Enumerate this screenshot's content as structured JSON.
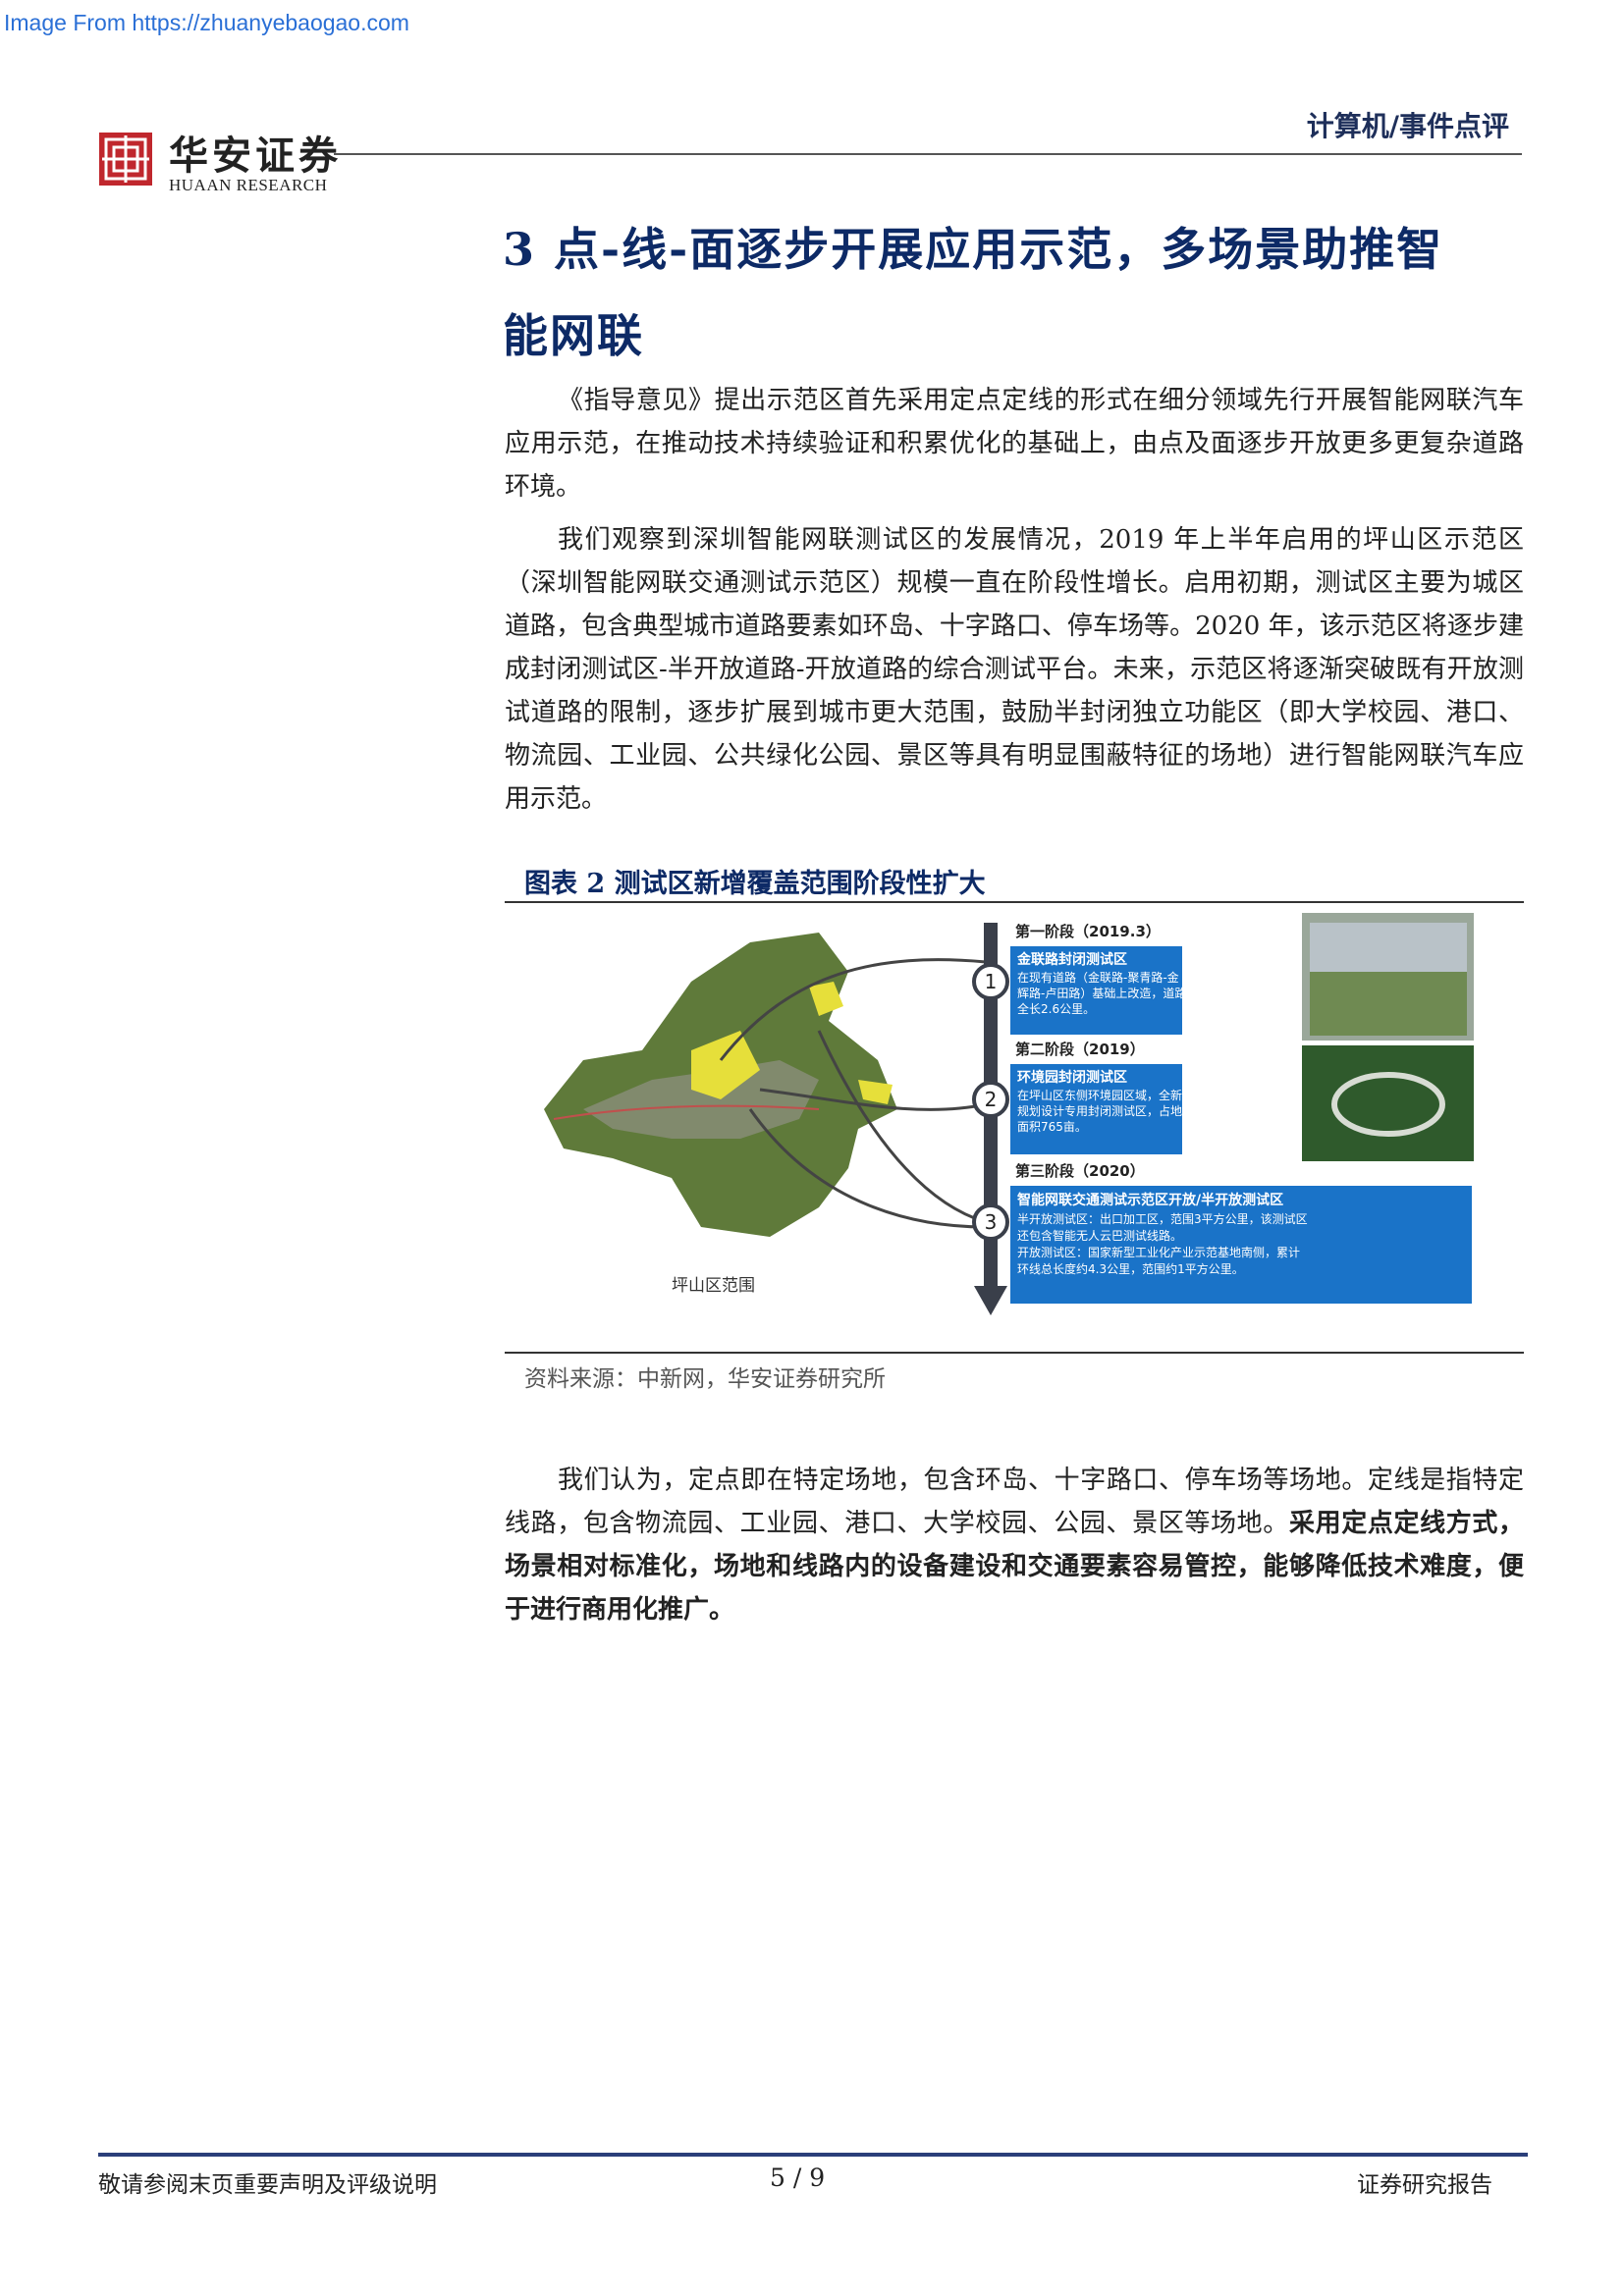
{
  "watermark": "Image From https://zhuanyebaogao.com",
  "header": {
    "logo_cn": "华安证券",
    "logo_en": "HUAAN RESEARCH",
    "category": "计算机/事件点评"
  },
  "section": {
    "title_line1": "3 点-线-面逐步开展应用示范，多场景助推智",
    "title_line2": "能网联"
  },
  "paragraphs": {
    "p1": "《指导意见》提出示范区首先采用定点定线的形式在细分领域先行开展智能网联汽车应用示范，在推动技术持续验证和积累优化的基础上，由点及面逐步开放更多更复杂道路环境。",
    "p2": "我们观察到深圳智能网联测试区的发展情况，2019 年上半年启用的坪山区示范区（深圳智能网联交通测试示范区）规模一直在阶段性增长。启用初期，测试区主要为城区道路，包含典型城市道路要素如环岛、十字路口、停车场等。2020 年，该示范区将逐步建成封闭测试区-半开放道路-开放道路的综合测试平台。未来，示范区将逐渐突破既有开放测试道路的限制，逐步扩展到城市更大范围，鼓励半封闭独立功能区（即大学校园、港口、物流园、工业园、公共绿化公园、景区等具有明显围蔽特征的场地）进行智能网联汽车应用示范。",
    "p3_normal": "我们认为，定点即在特定场地，包含环岛、十字路口、停车场等场地。定线是指特定线路，包含物流园、工业园、港口、大学校园、公园、景区等场地。",
    "p3_bold": "采用定点定线方式，场景相对标准化，场地和线路内的设备建设和交通要素容易管控，能够降低技术难度，便于进行商用化推广。"
  },
  "figure": {
    "title": "图表 2 测试区新增覆盖范围阶段性扩大",
    "map_label": "坪山区范围",
    "stages": [
      {
        "num": "1",
        "header": "第一阶段（2019.3）",
        "box_title": "金联路封闭测试区",
        "box_lines": [
          "在现有道路（金联路-聚青路-金",
          "辉路-卢田路）基础上改造，道路",
          "全长2.6公里。"
        ]
      },
      {
        "num": "2",
        "header": "第二阶段（2019）",
        "box_title": "环境园封闭测试区",
        "box_lines": [
          "在坪山区东侧环境园区域，全新",
          "规划设计专用封闭测试区，占地",
          "面积765亩。"
        ]
      },
      {
        "num": "3",
        "header": "第三阶段（2020）",
        "box_title": "智能网联交通测试示范区开放/半开放测试区",
        "box_lines": [
          "半开放测试区：出口加工区，范围3平方公里，该测试区",
          "还包含智能无人云巴测试线路。",
          "开放测试区：国家新型工业化产业示范基地南侧，累计",
          "环线总长度约4.3公里，范围约1平方公里。"
        ]
      }
    ],
    "source": "资料来源：中新网，华安证券研究所"
  },
  "footer": {
    "left": "敬请参阅末页重要声明及评级说明",
    "page": "5 / 9",
    "right": "证券研究报告"
  },
  "colors": {
    "title_blue": "#0d2a66",
    "stage_box": "#1a73c8",
    "arrow_gray": "#3a3f4a"
  }
}
